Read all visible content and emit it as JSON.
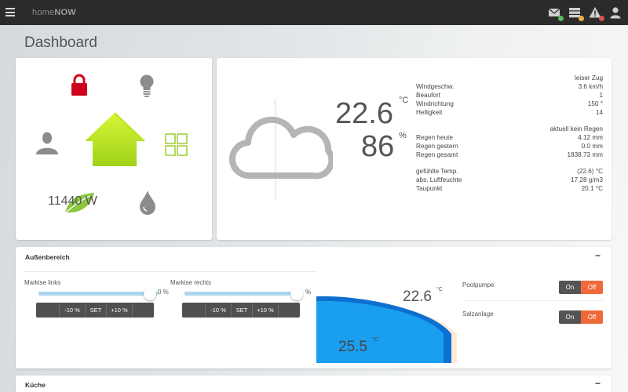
{
  "app": {
    "brand_light": "home",
    "brand_bold": "NOW"
  },
  "page": {
    "title": "Dashboard"
  },
  "topbar_icons": [
    {
      "name": "mail-icon",
      "badge_color": "#5cb85c"
    },
    {
      "name": "server-icon",
      "badge_color": "#f0ad4e"
    },
    {
      "name": "warning-icon",
      "badge_color": "#d9534f"
    },
    {
      "name": "user-icon",
      "badge_color": ""
    }
  ],
  "home": {
    "power": "11440 W",
    "colors": {
      "lock": "#d0021b",
      "house": "#b8e61e",
      "leaf": "#8cc63f",
      "gray": "#8c8c8c",
      "grid": "#9acd32"
    }
  },
  "weather": {
    "temperature": "22.6",
    "temperature_unit": "°C",
    "humidity": "86",
    "humidity_unit": "%",
    "wind_note": "leiser Zug",
    "wind_rows": [
      {
        "label": "Windgeschw.",
        "value": "3.6 km/h"
      },
      {
        "label": "Beaufort",
        "value": "1"
      },
      {
        "label": "Windrichtung",
        "value": "150 °"
      },
      {
        "label": "Helligkeit",
        "value": "14"
      }
    ],
    "rain_note": "aktuell kein Regen",
    "rain_rows": [
      {
        "label": "Regen heute",
        "value": "4.12 mm"
      },
      {
        "label": "Regen gestern",
        "value": "0.0 mm"
      },
      {
        "label": "Regen gesamt",
        "value": "1838.73 mm"
      }
    ],
    "climate_rows": [
      {
        "label": "gefühlte Temp.",
        "value": "(22.6) °C"
      },
      {
        "label": "abs. Luftfeuchte",
        "value": "17.28 g/m3"
      },
      {
        "label": "Taupunkt",
        "value": "20.1 °C"
      }
    ]
  },
  "outdoor": {
    "title": "Außenbereich",
    "collapse": "−",
    "blinds": [
      {
        "label": "Markise links",
        "pct_suffix": "0 %",
        "level": 1.0,
        "buttons": [
          "-10 %",
          "SET",
          "+10 %"
        ]
      },
      {
        "label": "Markise rechts",
        "pct_suffix": "%",
        "level": 1.0,
        "buttons": [
          "-10 %",
          "SET",
          "+10 %"
        ]
      }
    ],
    "pool": {
      "target": "22.6",
      "target_unit": "°C",
      "actual": "25.5",
      "actual_unit": "°C",
      "water_color": "#1a9ff0",
      "water_dark": "#0d6fd0"
    },
    "switches": [
      {
        "label": "Poolpumpe",
        "on": "On",
        "off": "Off"
      },
      {
        "label": "Salzanlage",
        "on": "On",
        "off": "Off"
      }
    ]
  },
  "kitchen": {
    "title": "Küche",
    "collapse": "−"
  }
}
